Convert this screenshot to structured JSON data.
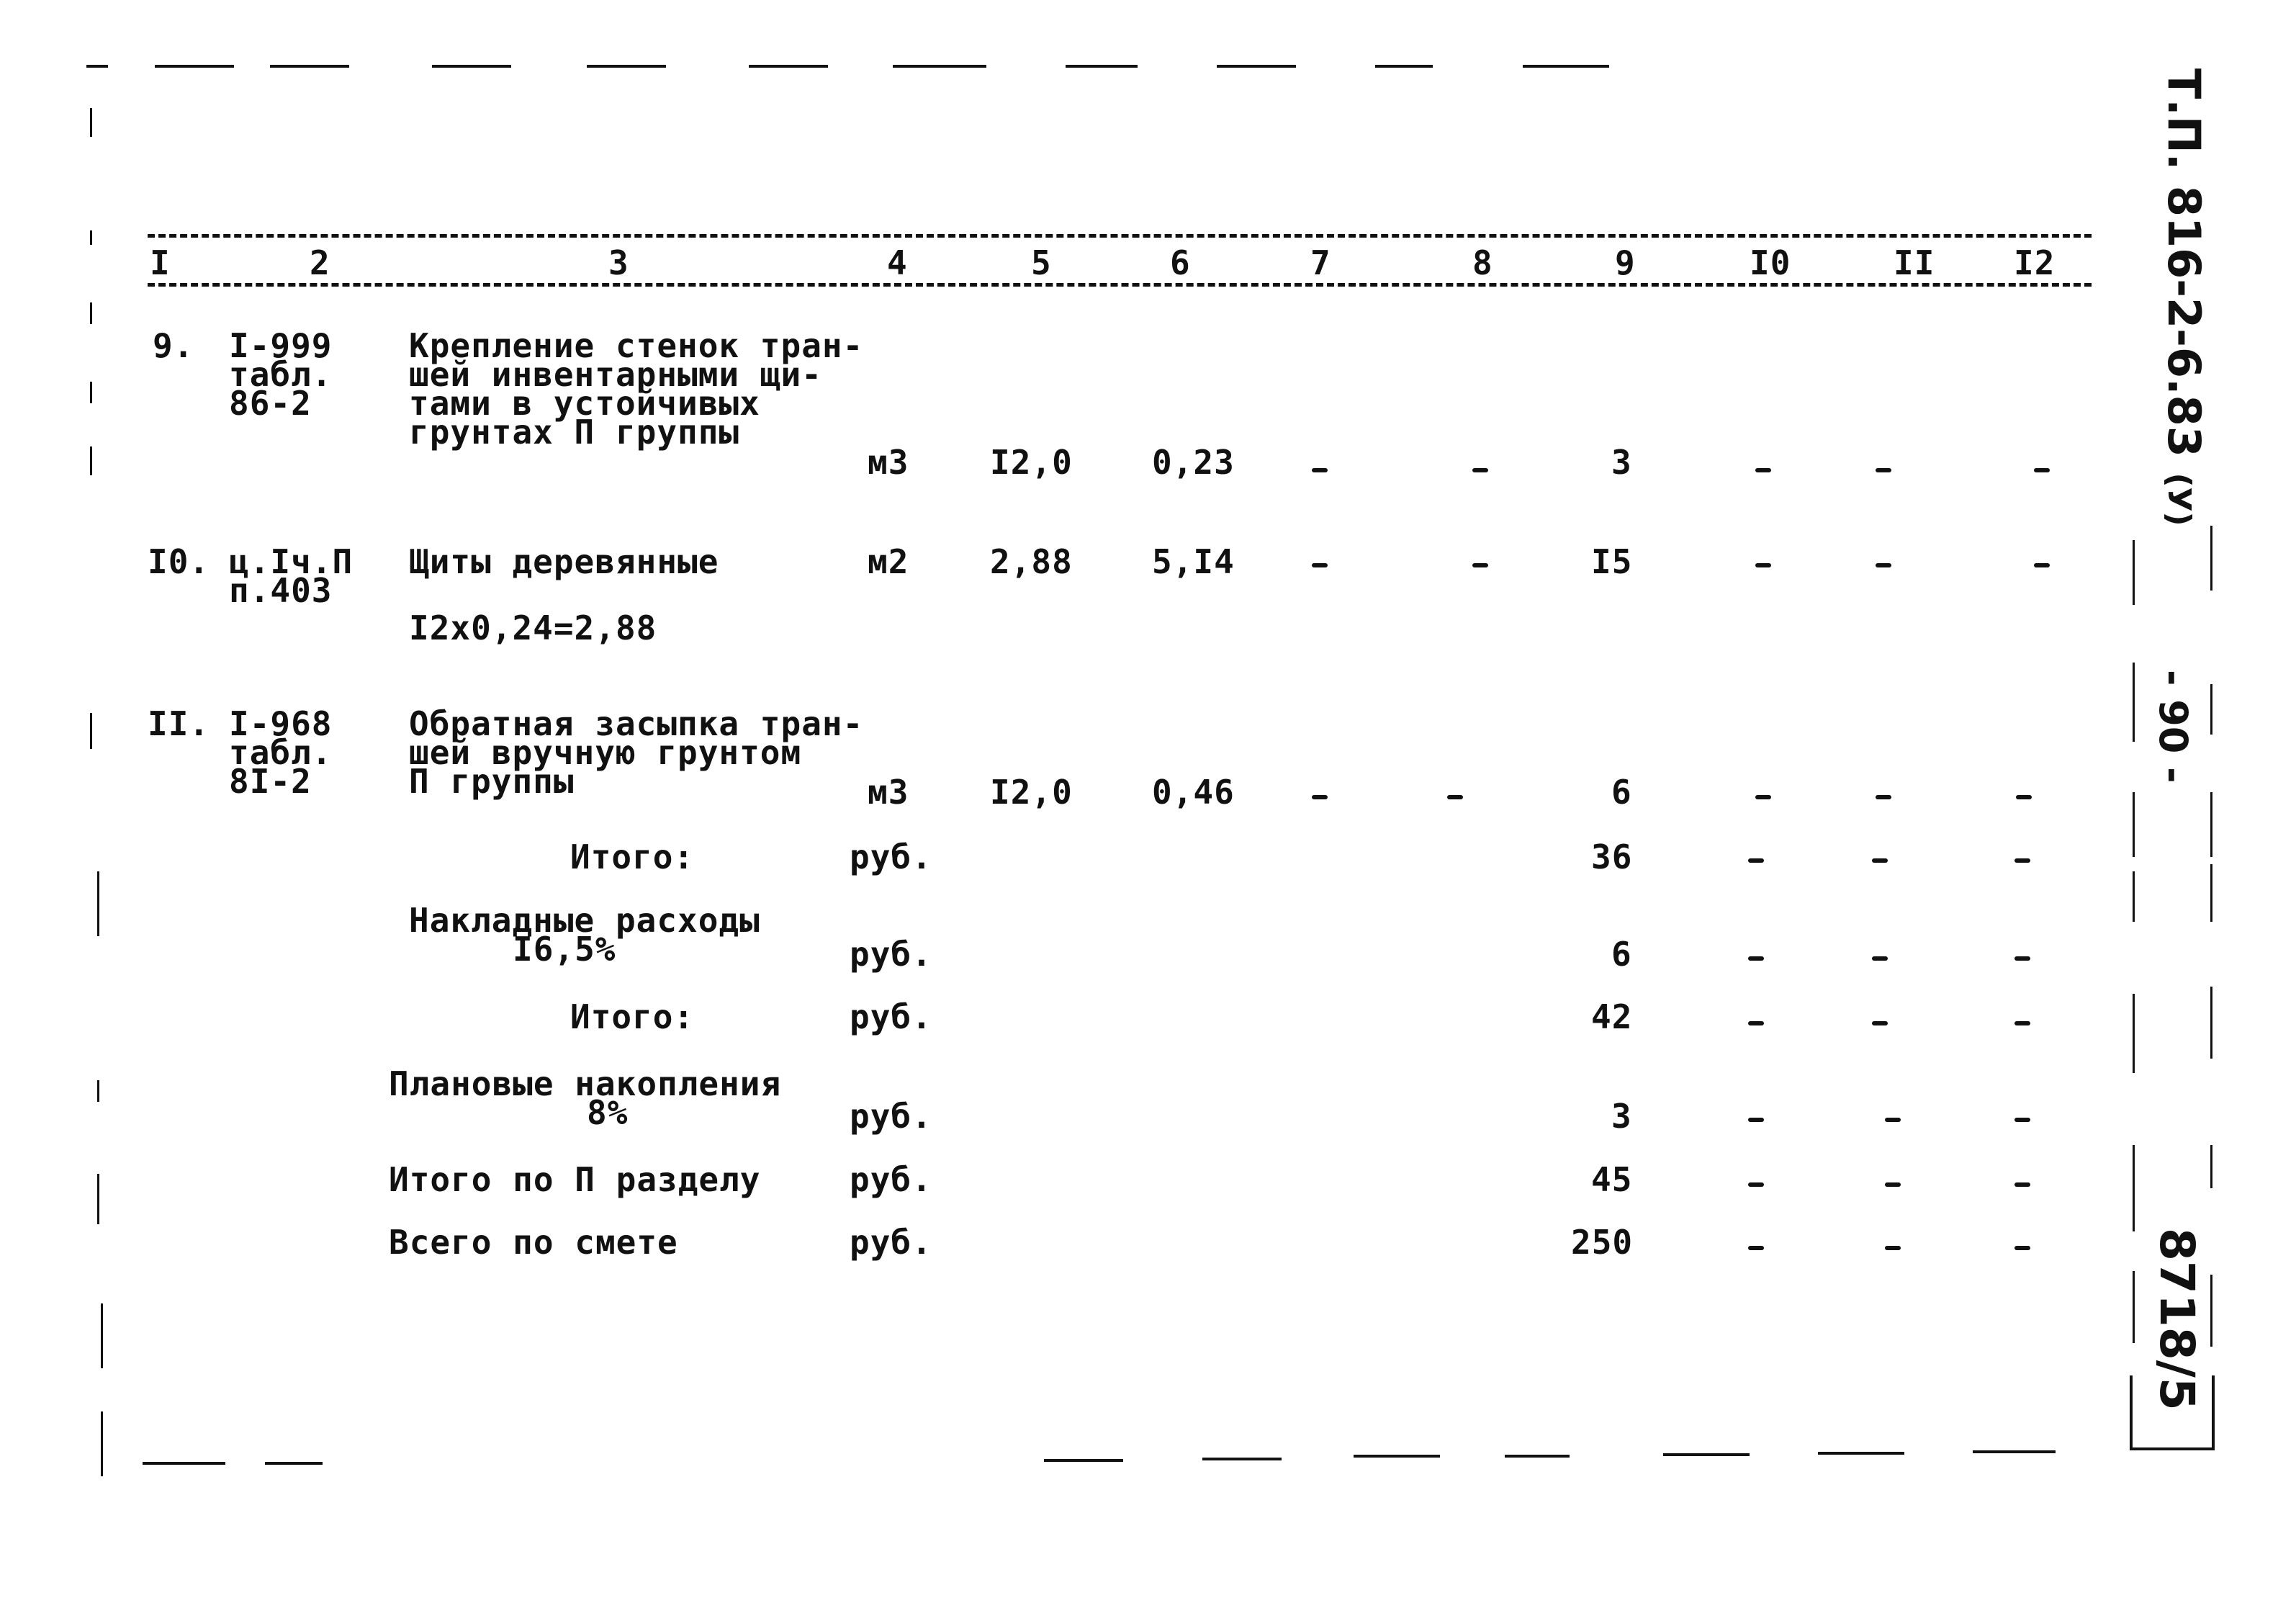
{
  "document": {
    "stamp_code": "Т.П. 816-2-6.83",
    "stamp_code_suffix": "(У)",
    "page_number": "- 90 -",
    "sheet_code": "8718/5"
  },
  "columns": [
    "I",
    "2",
    "3",
    "4",
    "5",
    "6",
    "7",
    "8",
    "9",
    "I0",
    "II",
    "I2"
  ],
  "rows": [
    {
      "num": "9.",
      "ref": [
        "I-999",
        "табл.",
        "86-2"
      ],
      "desc": [
        "Крепление стенок тран-",
        "шей инвентарными щи-",
        "тами в устойчивых",
        "грунтах П группы"
      ],
      "unit": "м3",
      "qty": "I2,0",
      "price": "0,23",
      "c7": "-",
      "c8": "-",
      "c9": "3",
      "c10": "-",
      "c11": "-",
      "c12": "-"
    },
    {
      "num": "I0.",
      "ref": [
        "ц.Iч.П",
        "п.403"
      ],
      "desc": [
        "Щиты деревянные"
      ],
      "note": "I2x0,24=2,88",
      "unit": "м2",
      "qty": "2,88",
      "price": "5,I4",
      "c7": "-",
      "c8": "-",
      "c9": "I5",
      "c10": "-",
      "c11": "-",
      "c12": "-"
    },
    {
      "num": "II.",
      "ref": [
        "I-968",
        "табл.",
        "8I-2"
      ],
      "desc": [
        "Обратная засыпка тран-",
        "шей вручную грунтом",
        "П группы"
      ],
      "unit": "м3",
      "qty": "I2,0",
      "price": "0,46",
      "c7": "-",
      "c8": "-",
      "c9": "6",
      "c10": "-",
      "c11": "-",
      "c12": "-"
    }
  ],
  "summary": [
    {
      "label": "Итого:",
      "sub": "",
      "unit": "руб.",
      "c9": "36",
      "c10": "-",
      "c11": "-",
      "c12": "-"
    },
    {
      "label": "Накладные расходы",
      "sub": "I6,5%",
      "unit": "руб.",
      "c9": "6",
      "c10": "-",
      "c11": "-",
      "c12": "-"
    },
    {
      "label": "Итого:",
      "sub": "",
      "unit": "руб.",
      "c9": "42",
      "c10": "-",
      "c11": "-",
      "c12": "-"
    },
    {
      "label": "Плановые накопления",
      "sub": "8%",
      "unit": "руб.",
      "c9": "3",
      "c10": "-",
      "c11": "-",
      "c12": "-"
    },
    {
      "label": "Итого по П разделу",
      "sub": "",
      "unit": "руб.",
      "c9": "45",
      "c10": "-",
      "c11": "-",
      "c12": "-"
    },
    {
      "label": "Всего по смете",
      "sub": "",
      "unit": "руб.",
      "c9": "250",
      "c10": "-",
      "c11": "-",
      "c12": "-"
    }
  ]
}
